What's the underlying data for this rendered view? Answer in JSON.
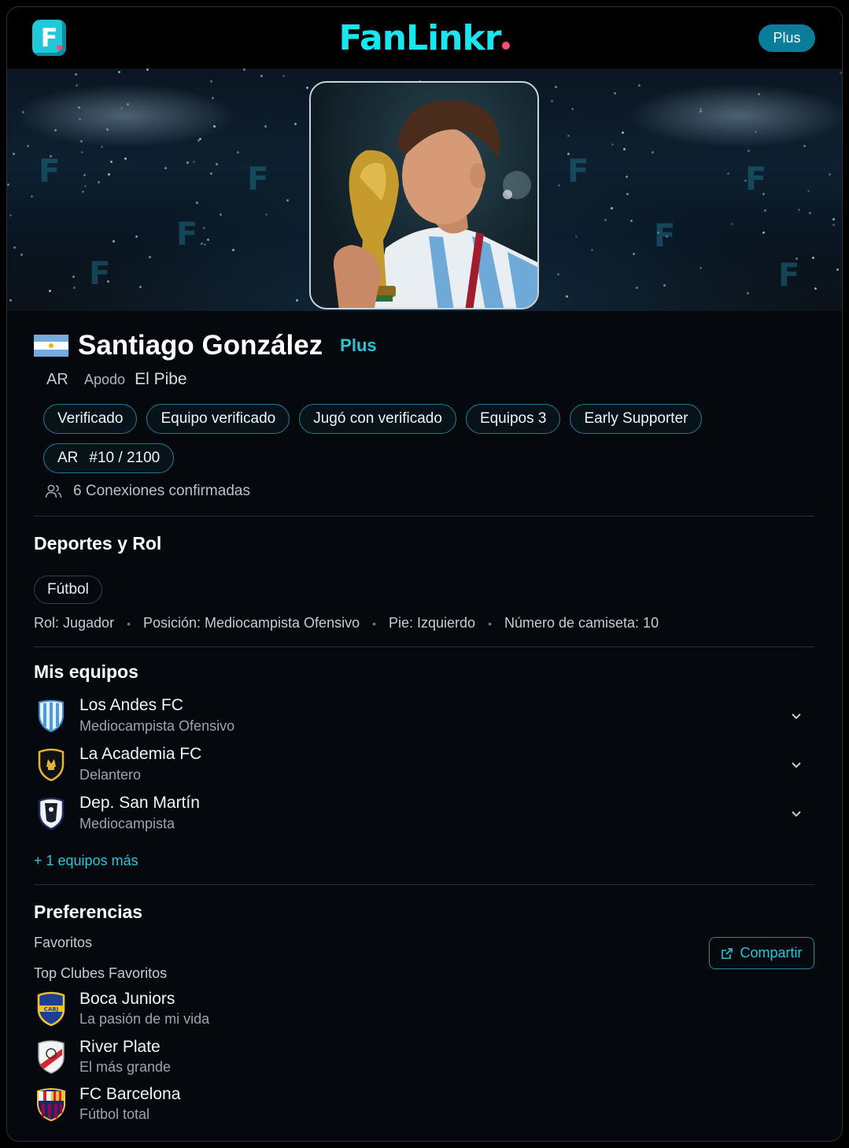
{
  "header": {
    "brand": "FanLinkr",
    "plan_button": "Plus"
  },
  "profile": {
    "name": "Santiago González",
    "plan_tag": "Plus",
    "country_code": "AR",
    "nickname_label": "Apodo",
    "nickname": "El Pibe",
    "badges": [
      "Verificado",
      "Equipo verificado",
      "Jugó con verificado",
      "Equipos 3",
      "Early Supporter"
    ],
    "rank_country": "AR",
    "rank": "#10 / 2100",
    "connections": "6 Conexiones confirmadas"
  },
  "sports": {
    "title": "Deportes y Rol",
    "sport": "Fútbol",
    "role": "Rol: Jugador",
    "position": "Posición: Mediocampista Ofensivo",
    "foot": "Pie: Izquierdo",
    "shirt": "Número de camiseta: 10"
  },
  "teams": {
    "title": "Mis equipos",
    "items": [
      {
        "name": "Los Andes FC",
        "role": "Mediocampista Ofensivo",
        "icon": "shield-stripes-icon"
      },
      {
        "name": "La Academia FC",
        "role": "Delantero",
        "icon": "shield-gold-icon"
      },
      {
        "name": "Dep. San Martín",
        "role": "Mediocampista",
        "icon": "shield-bw-icon"
      }
    ],
    "more": "+ 1 equipos más"
  },
  "preferences": {
    "title": "Preferencias",
    "favorites_label": "Favoritos",
    "share_button": "Compartir",
    "top_clubs_label": "Top Clubes Favoritos",
    "clubs": [
      {
        "name": "Boca Juniors",
        "desc": "La pasión de mi vida",
        "icon": "boca-crest-icon"
      },
      {
        "name": "River Plate",
        "desc": "El más grande",
        "icon": "river-crest-icon"
      },
      {
        "name": "FC Barcelona",
        "desc": "Fútbol total",
        "icon": "barca-crest-icon"
      }
    ]
  },
  "colors": {
    "accent": "#2ac4d8",
    "brand": "#17e6ef",
    "background": "#05090e"
  }
}
